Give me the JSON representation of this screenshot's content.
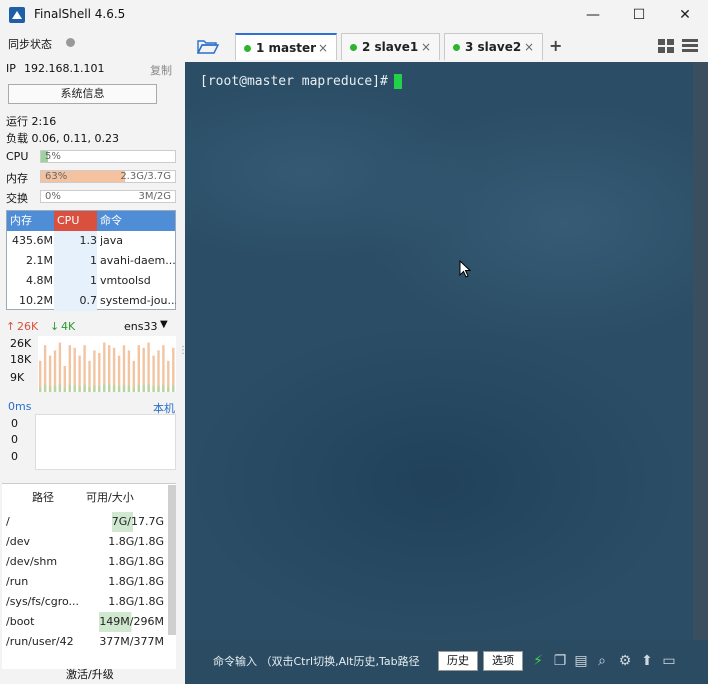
{
  "app": {
    "title": "FinalShell 4.6.5"
  },
  "window": {
    "minimize": "—",
    "maximize": "☐",
    "close": "✕"
  },
  "sidebar": {
    "sync_label": "同步状态",
    "ip_label": "IP",
    "ip_value": "192.168.1.101",
    "copy_label": "复制",
    "sysinfo_button": "系统信息",
    "uptime": "运行 2:16",
    "load": "负载 0.06, 0.11, 0.23",
    "cpu": {
      "label": "CPU",
      "text": "5%",
      "fraction": 0.05,
      "color": "#9fd09f"
    },
    "mem": {
      "label": "内存",
      "text": "63%",
      "detail": "2.3G/3.7G",
      "fraction": 0.63,
      "color": "#f5c2a0"
    },
    "swap": {
      "label": "交换",
      "text": "0%",
      "detail": "3M/2G",
      "fraction": 0.0
    },
    "process_headers": [
      "内存",
      "CPU",
      "命令"
    ],
    "processes": [
      {
        "mem": "435.6M",
        "cpu": "1.3",
        "cmd": "java"
      },
      {
        "mem": "2.1M",
        "cpu": "1",
        "cmd": "avahi-daem..."
      },
      {
        "mem": "4.8M",
        "cpu": "1",
        "cmd": "vmtoolsd"
      },
      {
        "mem": "10.2M",
        "cpu": "0.7",
        "cmd": "systemd-jou..."
      }
    ],
    "net": {
      "up": "26K",
      "down": "4K",
      "iface": "ens33",
      "ticks": [
        "26K",
        "18K",
        "9K"
      ],
      "bars": [
        0.6,
        0.9,
        0.7,
        0.8,
        0.95,
        0.5,
        0.9,
        0.85,
        0.7,
        0.9,
        0.6,
        0.8,
        0.75,
        0.95,
        0.9,
        0.85,
        0.7,
        0.9,
        0.8,
        0.6,
        0.9,
        0.85,
        0.95,
        0.7,
        0.8,
        0.9,
        0.6,
        0.85
      ]
    },
    "latency": {
      "label": "0ms",
      "host": "本机",
      "values": [
        "0",
        "0",
        "0"
      ]
    },
    "disk": {
      "headers": [
        "路径",
        "可用/大小"
      ],
      "rows": [
        {
          "path": "/",
          "size": "7G/17.7G",
          "fraction": 0.4
        },
        {
          "path": "/dev",
          "size": "1.8G/1.8G",
          "fraction": 0.0
        },
        {
          "path": "/dev/shm",
          "size": "1.8G/1.8G",
          "fraction": 0.0
        },
        {
          "path": "/run",
          "size": "1.8G/1.8G",
          "fraction": 0.0
        },
        {
          "path": "/sys/fs/cgro...",
          "size": "1.8G/1.8G",
          "fraction": 0.0
        },
        {
          "path": "/boot",
          "size": "149M/296M",
          "fraction": 0.5
        },
        {
          "path": "/run/user/42",
          "size": "377M/377M",
          "fraction": 0.0
        }
      ]
    },
    "activate": "激活/升级"
  },
  "tabs": [
    {
      "label": "1 master",
      "active": true
    },
    {
      "label": "2 slave1",
      "active": false
    },
    {
      "label": "3 slave2",
      "active": false
    }
  ],
  "tab_add": "+",
  "terminal": {
    "prompt": "[root@master mapreduce]#"
  },
  "command_bar": {
    "hint": "命令输入 （双击Ctrl切换,Alt历史,Tab路径",
    "history_button": "历史",
    "options_button": "选项"
  },
  "colors": {
    "terminal_bg": "#2b4e66",
    "accent": "#2f6fd6",
    "status_green": "#2db52d"
  }
}
